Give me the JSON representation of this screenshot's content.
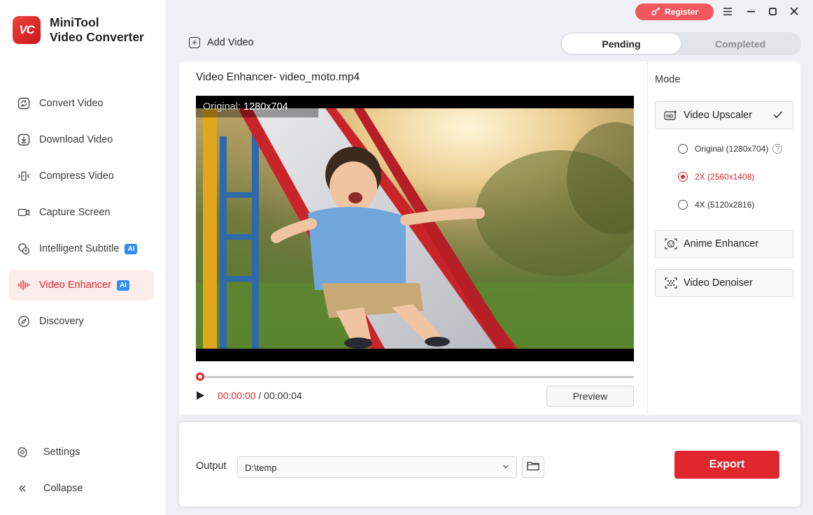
{
  "app": {
    "name_line1": "MiniTool",
    "name_line2": "Video Converter",
    "logo_text": "VC"
  },
  "sidebar": {
    "items": [
      {
        "label": "Convert Video",
        "icon": "convert-icon",
        "active": false
      },
      {
        "label": "Download Video",
        "icon": "download-icon",
        "active": false
      },
      {
        "label": "Compress Video",
        "icon": "compress-icon",
        "active": false
      },
      {
        "label": "Capture Screen",
        "icon": "camera-icon",
        "active": false
      },
      {
        "label": "Intelligent Subtitle",
        "icon": "subtitle-icon",
        "badge": "AI",
        "active": false
      },
      {
        "label": "Video Enhancer",
        "icon": "waveform-icon",
        "badge": "AI",
        "active": true
      },
      {
        "label": "Discovery",
        "icon": "compass-icon",
        "active": false
      }
    ],
    "settings_label": "Settings",
    "collapse_label": "Collapse"
  },
  "topbar": {
    "register_label": "Register",
    "add_video_label": "Add Video",
    "tabs": [
      {
        "label": "Pending",
        "active": true
      },
      {
        "label": "Completed",
        "active": false
      }
    ]
  },
  "editor": {
    "title": "Video Enhancer- video_moto.mp4",
    "original_key": "Original:",
    "original_value": "1280x704",
    "time_current": "00:00:00",
    "time_separator": "/",
    "time_total": "00:00:04",
    "playback_progress": 0,
    "preview_label": "Preview"
  },
  "mode": {
    "title": "Mode",
    "upscaler_label": "Video Upscaler",
    "options": [
      {
        "label": "Original (1280x704)",
        "selected": false,
        "help": true
      },
      {
        "label": "2X (2560x1408)",
        "selected": true
      },
      {
        "label": "4X (5120x2816)",
        "selected": false
      }
    ],
    "anime_label": "Anime Enhancer",
    "denoiser_label": "Video Denoiser",
    "upscaler_icon_text": "HD"
  },
  "output": {
    "label": "Output",
    "path": "D:\\temp",
    "export_label": "Export"
  },
  "colors": {
    "accent": "#e0262e",
    "register": "#f0585e",
    "badge": "#2f8ff0"
  }
}
